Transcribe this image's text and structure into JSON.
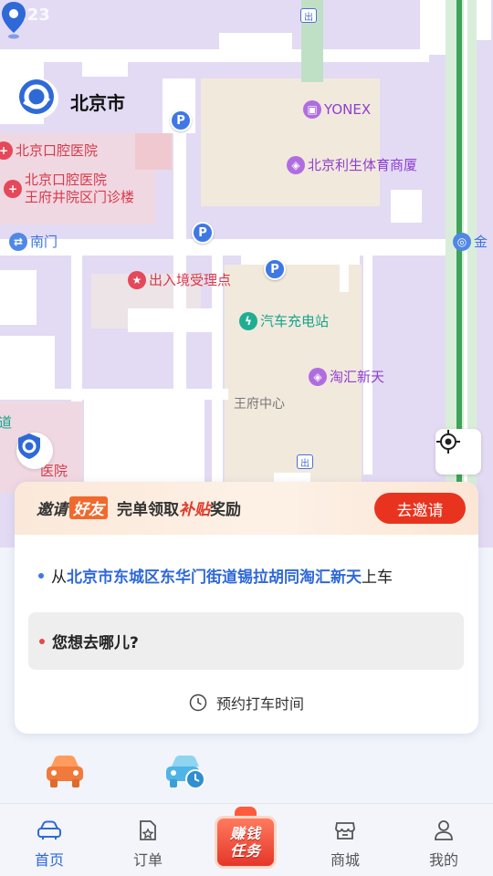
{
  "status_bar": {
    "time": "6:23"
  },
  "map": {
    "city": "北京市",
    "pois": {
      "yonex": "YONEX",
      "sports_store": "北京利生体育商厦",
      "dental_hospital": "北京口腔医院",
      "dental_branch_1": "北京口腔医院",
      "dental_branch_2": "王府井院区门诊楼",
      "south_gate": "南门",
      "immigration": "出入境受理点",
      "ev_charging": "汽车充电站",
      "taohui": "淘汇新天",
      "wangfu_center": "王府中心",
      "gold_partial": "金",
      "road_partial": "道",
      "hospital_partial": "医院"
    },
    "parking_label": "P",
    "metro_label": "出"
  },
  "invite": {
    "prefix": "邀请",
    "badge": "好友",
    "middle": "完单领取",
    "highlight": "补贴",
    "suffix": "奖励",
    "button": "去邀请"
  },
  "pickup": {
    "from_prefix": "从",
    "address": "北京市东城区东华门街道锡拉胡同淘汇新天",
    "from_suffix": "上车"
  },
  "destination": {
    "placeholder": "您想去哪儿?"
  },
  "schedule": {
    "label": "预约打车时间"
  },
  "tabs": [
    {
      "label": "首页",
      "icon": "car-icon",
      "active": true
    },
    {
      "label": "订单",
      "icon": "order-icon",
      "active": false
    },
    {
      "label": "赚钱任务",
      "icon": "gift-icon",
      "active": false
    },
    {
      "label": "商城",
      "icon": "store-icon",
      "active": false
    },
    {
      "label": "我的",
      "icon": "person-icon",
      "active": false
    }
  ],
  "earn_task": {
    "line1": "赚钱",
    "line2": "任务"
  },
  "colors": {
    "brand_blue": "#2f69d8",
    "accent_red": "#e8341f",
    "map_bg": "#e3dbf3",
    "block": "#f2e9dd",
    "road": "#ffffff"
  }
}
